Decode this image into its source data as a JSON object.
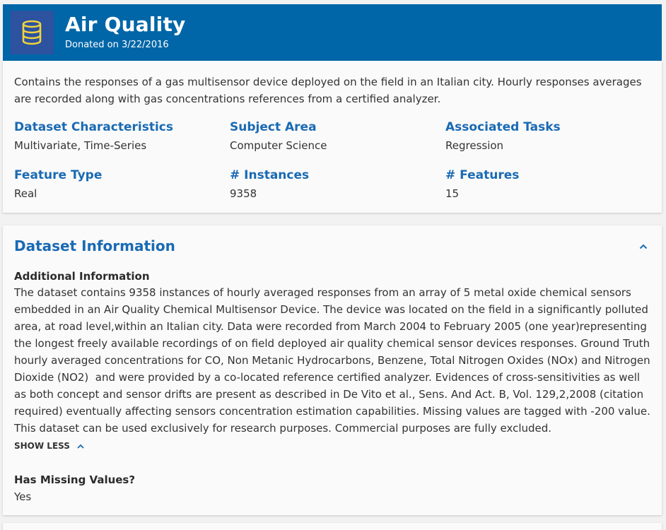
{
  "header": {
    "title": "Air Quality",
    "donated": "Donated on 3/22/2016",
    "icon": "database-icon",
    "bg_color": "#0066a8"
  },
  "summary": "Contains the responses of a gas multisensor device deployed on the field in an Italian city. Hourly responses averages are recorded along with gas concentrations references from a certified analyzer.",
  "characteristics": [
    {
      "label": "Dataset Characteristics",
      "value": "Multivariate, Time-Series"
    },
    {
      "label": "Subject Area",
      "value": "Computer Science"
    },
    {
      "label": "Associated Tasks",
      "value": "Regression"
    },
    {
      "label": "Feature Type",
      "value": "Real"
    },
    {
      "label": "# Instances",
      "value": "9358"
    },
    {
      "label": "# Features",
      "value": "15"
    }
  ],
  "info": {
    "title": "Dataset Information",
    "collapse_icon": "chevron-up-icon",
    "additional_label": "Additional Information",
    "paragraphs": [
      "The dataset contains 9358 instances of hourly averaged responses from an array of 5 metal oxide chemical sensors embedded in an Air Quality Chemical Multisensor Device. The device was located on the field in a significantly polluted area, at road level,within an Italian city. Data were recorded from March 2004 to February 2005 (one year)representing the longest freely available recordings of on field deployed air quality chemical sensor devices responses. Ground Truth hourly averaged concentrations for CO, Non Metanic Hydrocarbons, Benzene, Total Nitrogen Oxides (NOx) and Nitrogen Dioxide (NO2)  and were provided by a co-located reference certified analyzer. Evidences of cross-sensitivities as well as both concept and sensor drifts are present as described in De Vito et al., Sens. And Act. B, Vol. 129,2,2008 (citation required) eventually affecting sensors concentration estimation capabilities. Missing values are tagged with -200 value.",
      "This dataset can be used exclusively for research purposes. Commercial purposes are fully excluded."
    ],
    "show_less_label": "SHOW LESS",
    "missing_label": "Has Missing Values?",
    "missing_value": "Yes"
  }
}
